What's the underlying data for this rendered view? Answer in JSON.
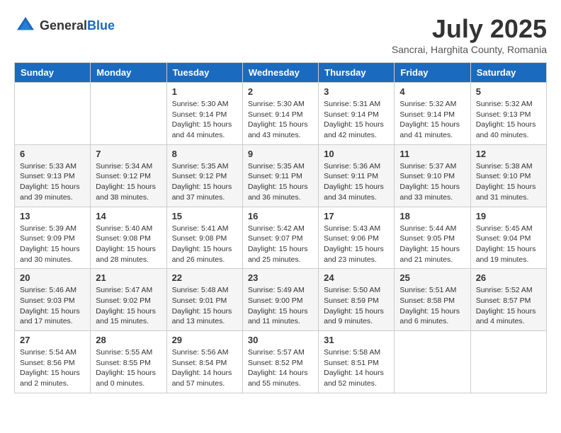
{
  "header": {
    "logo_general": "General",
    "logo_blue": "Blue",
    "month_title": "July 2025",
    "subtitle": "Sancrai, Harghita County, Romania"
  },
  "weekdays": [
    "Sunday",
    "Monday",
    "Tuesday",
    "Wednesday",
    "Thursday",
    "Friday",
    "Saturday"
  ],
  "weeks": [
    [
      {
        "day": "",
        "info": ""
      },
      {
        "day": "",
        "info": ""
      },
      {
        "day": "1",
        "info": "Sunrise: 5:30 AM\nSunset: 9:14 PM\nDaylight: 15 hours\nand 44 minutes."
      },
      {
        "day": "2",
        "info": "Sunrise: 5:30 AM\nSunset: 9:14 PM\nDaylight: 15 hours\nand 43 minutes."
      },
      {
        "day": "3",
        "info": "Sunrise: 5:31 AM\nSunset: 9:14 PM\nDaylight: 15 hours\nand 42 minutes."
      },
      {
        "day": "4",
        "info": "Sunrise: 5:32 AM\nSunset: 9:14 PM\nDaylight: 15 hours\nand 41 minutes."
      },
      {
        "day": "5",
        "info": "Sunrise: 5:32 AM\nSunset: 9:13 PM\nDaylight: 15 hours\nand 40 minutes."
      }
    ],
    [
      {
        "day": "6",
        "info": "Sunrise: 5:33 AM\nSunset: 9:13 PM\nDaylight: 15 hours\nand 39 minutes."
      },
      {
        "day": "7",
        "info": "Sunrise: 5:34 AM\nSunset: 9:12 PM\nDaylight: 15 hours\nand 38 minutes."
      },
      {
        "day": "8",
        "info": "Sunrise: 5:35 AM\nSunset: 9:12 PM\nDaylight: 15 hours\nand 37 minutes."
      },
      {
        "day": "9",
        "info": "Sunrise: 5:35 AM\nSunset: 9:11 PM\nDaylight: 15 hours\nand 36 minutes."
      },
      {
        "day": "10",
        "info": "Sunrise: 5:36 AM\nSunset: 9:11 PM\nDaylight: 15 hours\nand 34 minutes."
      },
      {
        "day": "11",
        "info": "Sunrise: 5:37 AM\nSunset: 9:10 PM\nDaylight: 15 hours\nand 33 minutes."
      },
      {
        "day": "12",
        "info": "Sunrise: 5:38 AM\nSunset: 9:10 PM\nDaylight: 15 hours\nand 31 minutes."
      }
    ],
    [
      {
        "day": "13",
        "info": "Sunrise: 5:39 AM\nSunset: 9:09 PM\nDaylight: 15 hours\nand 30 minutes."
      },
      {
        "day": "14",
        "info": "Sunrise: 5:40 AM\nSunset: 9:08 PM\nDaylight: 15 hours\nand 28 minutes."
      },
      {
        "day": "15",
        "info": "Sunrise: 5:41 AM\nSunset: 9:08 PM\nDaylight: 15 hours\nand 26 minutes."
      },
      {
        "day": "16",
        "info": "Sunrise: 5:42 AM\nSunset: 9:07 PM\nDaylight: 15 hours\nand 25 minutes."
      },
      {
        "day": "17",
        "info": "Sunrise: 5:43 AM\nSunset: 9:06 PM\nDaylight: 15 hours\nand 23 minutes."
      },
      {
        "day": "18",
        "info": "Sunrise: 5:44 AM\nSunset: 9:05 PM\nDaylight: 15 hours\nand 21 minutes."
      },
      {
        "day": "19",
        "info": "Sunrise: 5:45 AM\nSunset: 9:04 PM\nDaylight: 15 hours\nand 19 minutes."
      }
    ],
    [
      {
        "day": "20",
        "info": "Sunrise: 5:46 AM\nSunset: 9:03 PM\nDaylight: 15 hours\nand 17 minutes."
      },
      {
        "day": "21",
        "info": "Sunrise: 5:47 AM\nSunset: 9:02 PM\nDaylight: 15 hours\nand 15 minutes."
      },
      {
        "day": "22",
        "info": "Sunrise: 5:48 AM\nSunset: 9:01 PM\nDaylight: 15 hours\nand 13 minutes."
      },
      {
        "day": "23",
        "info": "Sunrise: 5:49 AM\nSunset: 9:00 PM\nDaylight: 15 hours\nand 11 minutes."
      },
      {
        "day": "24",
        "info": "Sunrise: 5:50 AM\nSunset: 8:59 PM\nDaylight: 15 hours\nand 9 minutes."
      },
      {
        "day": "25",
        "info": "Sunrise: 5:51 AM\nSunset: 8:58 PM\nDaylight: 15 hours\nand 6 minutes."
      },
      {
        "day": "26",
        "info": "Sunrise: 5:52 AM\nSunset: 8:57 PM\nDaylight: 15 hours\nand 4 minutes."
      }
    ],
    [
      {
        "day": "27",
        "info": "Sunrise: 5:54 AM\nSunset: 8:56 PM\nDaylight: 15 hours\nand 2 minutes."
      },
      {
        "day": "28",
        "info": "Sunrise: 5:55 AM\nSunset: 8:55 PM\nDaylight: 15 hours\nand 0 minutes."
      },
      {
        "day": "29",
        "info": "Sunrise: 5:56 AM\nSunset: 8:54 PM\nDaylight: 14 hours\nand 57 minutes."
      },
      {
        "day": "30",
        "info": "Sunrise: 5:57 AM\nSunset: 8:52 PM\nDaylight: 14 hours\nand 55 minutes."
      },
      {
        "day": "31",
        "info": "Sunrise: 5:58 AM\nSunset: 8:51 PM\nDaylight: 14 hours\nand 52 minutes."
      },
      {
        "day": "",
        "info": ""
      },
      {
        "day": "",
        "info": ""
      }
    ]
  ]
}
